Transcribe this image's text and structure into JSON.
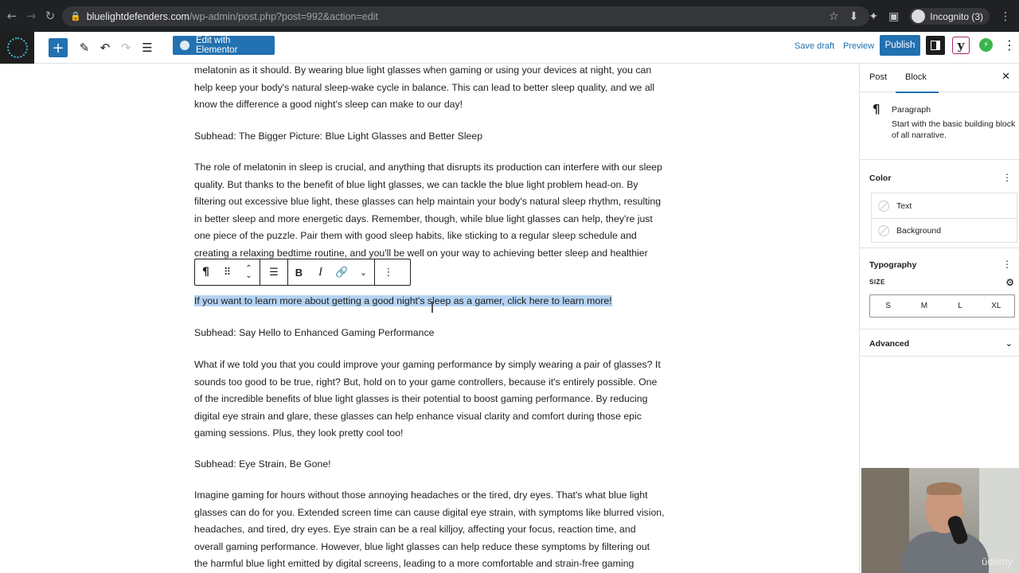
{
  "browser": {
    "url_host": "bluelightdefenders.com",
    "url_path": "/wp-admin/post.php?post=992&action=edit",
    "profile_label": "Incognito (3)"
  },
  "toolbar": {
    "elementor_label": "Edit with Elementor",
    "save_draft_label": "Save draft",
    "preview_label": "Preview",
    "publish_label": "Publish",
    "yoast_label": "y"
  },
  "content": {
    "paragraphs": [
      "melatonin as it should. By wearing blue light glasses when gaming or using your devices at night, you can help keep your body's natural sleep-wake cycle in balance. This can lead to better sleep quality, and we all know the difference a good night's sleep can make to our day!",
      "Subhead: The Bigger Picture: Blue Light Glasses and Better Sleep",
      "The role of melatonin in sleep is crucial, and anything that disrupts its production can interfere with our sleep quality. But thanks to the benefit of blue light glasses, we can tackle the blue light problem head-on. By filtering out excessive blue light, these glasses can help maintain your body's natural sleep rhythm, resulting in better sleep and more energetic days. Remember, though, while blue light glasses can help, they're just one piece of the puzzle. Pair them with good sleep habits, like sticking to a regular sleep schedule and creating a relaxing bedtime routine, and you'll be well on your way to achieving better sleep and healthier",
      "If you want to learn more about getting a good night's sleep as a gamer, click here to learn more!",
      "Subhead: Say Hello to Enhanced Gaming Performance",
      "What if we told you that you could improve your gaming performance by simply wearing a pair of glasses? It sounds too good to be true, right? But, hold on to your game controllers, because it's entirely possible. One of the incredible benefits of blue light glasses is their potential to boost gaming performance. By reducing digital eye strain and glare, these glasses can help enhance visual clarity and comfort during those epic gaming sessions. Plus, they look pretty cool too!",
      "Subhead: Eye Strain, Be Gone!",
      "Imagine gaming for hours without those annoying headaches or the tired, dry eyes. That's what blue light glasses can do for you. Extended screen time can cause digital eye strain, with symptoms like blurred vision, headaches, and tired, dry eyes. Eye strain can be a real killjoy, affecting your focus, reaction time, and overall gaming performance. However, blue light glasses can help reduce these symptoms by filtering out the harmful blue light emitted by digital screens, leading to a more comfortable and strain-free gaming"
    ]
  },
  "sidebar": {
    "tabs": [
      "Post",
      "Block"
    ],
    "active_tab": "Block",
    "block_name": "Paragraph",
    "block_description": "Start with the basic building block of all narrative.",
    "color_title": "Color",
    "color_items": [
      "Text",
      "Background"
    ],
    "typography_title": "Typography",
    "size_label": "SIZE",
    "sizes": [
      "S",
      "M",
      "L",
      "XL"
    ],
    "advanced_title": "Advanced"
  },
  "webcam": {
    "watermark": "ūdemy"
  },
  "colors": {
    "accent": "#2271b1",
    "selection": "#b4d3f3",
    "browser_chrome": "#202124"
  }
}
